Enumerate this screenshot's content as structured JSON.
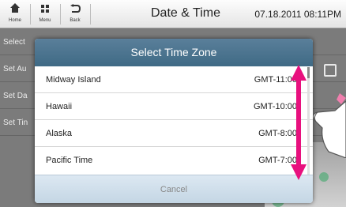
{
  "topbar": {
    "home_label": "Home",
    "menu_label": "Menu",
    "back_label": "Back",
    "title": "Date & Time",
    "datetime": "07.18.2011 08:11PM"
  },
  "background_rows": [
    {
      "label": "Select"
    },
    {
      "label": "Set Au"
    },
    {
      "label": "Set Da"
    },
    {
      "label": "Set Tin"
    }
  ],
  "dialog": {
    "title": "Select Time Zone",
    "zones": [
      {
        "name": "Midway Island",
        "offset": "GMT-11:00"
      },
      {
        "name": "Hawaii",
        "offset": "GMT-10:00"
      },
      {
        "name": "Alaska",
        "offset": "GMT-8:00"
      },
      {
        "name": "Pacific Time",
        "offset": "GMT-7:00"
      }
    ],
    "cancel_label": "Cancel"
  },
  "colors": {
    "accent_arrow": "#e8107e",
    "dialog_header": "#4b7490",
    "dim_background": "#7b7b7b"
  }
}
